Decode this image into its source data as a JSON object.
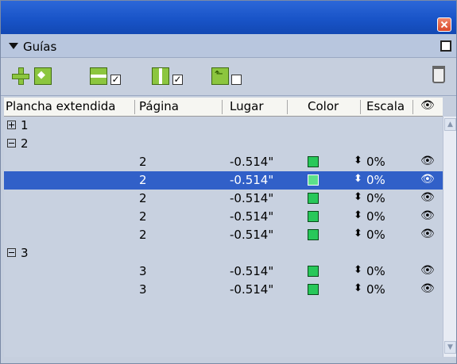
{
  "panel": {
    "title": "Guías"
  },
  "columns": [
    "Plancha extendida",
    "Página",
    "Lugar",
    "Color",
    "Escala"
  ],
  "groups": [
    {
      "label": "1",
      "expanded": false
    },
    {
      "label": "2",
      "expanded": true
    },
    {
      "label": "3",
      "expanded": true
    }
  ],
  "rows": [
    {
      "pagina": "2",
      "lugar": "-0.514\"",
      "escala": "0%",
      "selected": false
    },
    {
      "pagina": "2",
      "lugar": "-0.514\"",
      "escala": "0%",
      "selected": true
    },
    {
      "pagina": "2",
      "lugar": "-0.514\"",
      "escala": "0%",
      "selected": false
    },
    {
      "pagina": "2",
      "lugar": "-0.514\"",
      "escala": "0%",
      "selected": false
    },
    {
      "pagina": "2",
      "lugar": "-0.514\"",
      "escala": "0%",
      "selected": false
    },
    {
      "pagina": "3",
      "lugar": "-0.514\"",
      "escala": "0%",
      "selected": false
    },
    {
      "pagina": "3",
      "lugar": "-0.514\"",
      "escala": "0%",
      "selected": false
    }
  ],
  "colors": {
    "guide_color": "#28c85a",
    "selection": "#3160c8"
  }
}
